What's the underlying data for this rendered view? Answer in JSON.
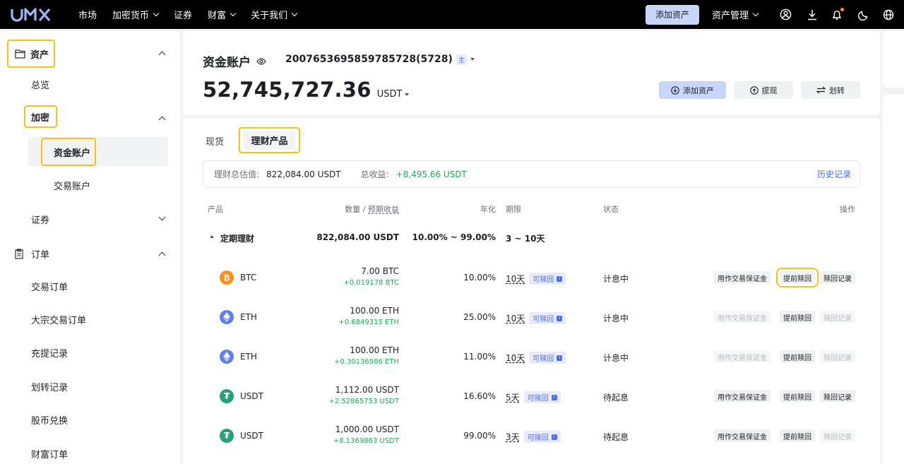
{
  "brand": {
    "logo_text": "UMX"
  },
  "topnav": {
    "items": [
      {
        "label": "市场",
        "has_dropdown": false
      },
      {
        "label": "加密货币",
        "has_dropdown": true
      },
      {
        "label": "证券",
        "has_dropdown": false
      },
      {
        "label": "财富",
        "has_dropdown": true
      },
      {
        "label": "关于我们",
        "has_dropdown": true
      }
    ],
    "add_asset": "添加资产",
    "asset_mgmt": "资产管理"
  },
  "sidebar": {
    "assets": "资产",
    "overview": "总览",
    "crypto": "加密",
    "fund_account": "资金账户",
    "trade_account": "交易账户",
    "securities": "证券",
    "orders": "订单",
    "order_items": [
      "交易订单",
      "大宗交易订单",
      "充提记录",
      "划转记录",
      "股币兑换",
      "财富订单"
    ]
  },
  "header": {
    "title": "资金账户",
    "account_id": "2007653695859785728(5728)",
    "account_badge": "主",
    "balance": "52,745,727.36",
    "currency": "USDT",
    "add_asset": "添加资产",
    "withdraw": "提现",
    "transfer": "划转"
  },
  "tabs": {
    "spot": "现货",
    "wealth": "理财产品"
  },
  "summary": {
    "total_label": "理财总估值:",
    "total_value": "822,084.00 USDT",
    "profit_label": "总收益:",
    "profit_value": "+8,495.66 USDT",
    "history": "历史记录"
  },
  "table": {
    "headers": {
      "product": "产品",
      "qty": "数量",
      "qty_sep": " / ",
      "est": "预期收益",
      "apr": "年化",
      "term": "期限",
      "status": "状态",
      "action": "操作"
    },
    "group": {
      "name": "定期理财",
      "amount": "822,084.00 USDT",
      "apr": "10.00% ~ 99.00%",
      "term": "3 ~ 10天"
    },
    "rows": [
      {
        "coin": "BTC",
        "amount": "7.00 BTC",
        "est": "+0.019178 BTC",
        "apr": "10.00%",
        "term": "10天",
        "redeemable": "可赎回",
        "status": "计息中",
        "btn1": "用作交易保证金",
        "btn2": "提前赎回",
        "btn3": "赎回记录",
        "btn1_disabled": false,
        "btn3_disabled": false
      },
      {
        "coin": "ETH",
        "amount": "100.00 ETH",
        "est": "+0.6849315 ETH",
        "apr": "25.00%",
        "term": "10天",
        "redeemable": "可赎回",
        "status": "计息中",
        "btn1": "用作交易保证金",
        "btn2": "提前赎回",
        "btn3": "赎回记录",
        "btn1_disabled": true,
        "btn3_disabled": true
      },
      {
        "coin": "ETH",
        "amount": "100.00 ETH",
        "est": "+0.30136986 ETH",
        "apr": "11.00%",
        "term": "10天",
        "redeemable": "可赎回",
        "status": "计息中",
        "btn1": "用作交易保证金",
        "btn2": "提前赎回",
        "btn3": "赎回记录",
        "btn1_disabled": true,
        "btn3_disabled": true
      },
      {
        "coin": "USDT",
        "amount": "1,112.00 USDT",
        "est": "+2.52865753 USDT",
        "apr": "16.60%",
        "term": "5天",
        "redeemable": "可赎回",
        "status": "待起息",
        "btn1": "用作交易保证金",
        "btn2": "提前赎回",
        "btn3": "赎回记录",
        "btn1_disabled": false,
        "btn3_disabled": false
      },
      {
        "coin": "USDT",
        "amount": "1,000.00 USDT",
        "est": "+8.1369863 USDT",
        "apr": "99.00%",
        "term": "3天",
        "redeemable": "可赎回",
        "status": "待起息",
        "btn1": "用作交易保证金",
        "btn2": "提前赎回",
        "btn3": "赎回记录",
        "btn1_disabled": false,
        "btn3_disabled": true
      }
    ]
  },
  "colors": {
    "btc": "#f7931a",
    "eth": "#627eea",
    "usdt": "#26a17b",
    "highlight": "#f7c31a",
    "accent": "#3e6ef5",
    "positive": "#26a65b"
  }
}
